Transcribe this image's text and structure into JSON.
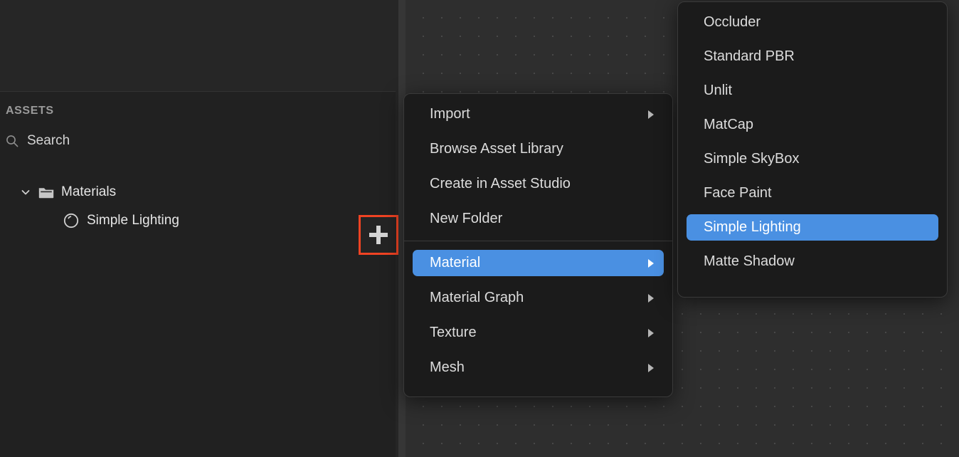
{
  "colors": {
    "accent_highlight": "#4a90e2",
    "annotation_outline": "#f04323",
    "panel_background": "#242424",
    "menu_background": "#1b1b1b",
    "viewport_background": "#2e2e2e",
    "text_primary": "#e6e6e6",
    "text_muted": "#9a9a9a"
  },
  "assets_panel": {
    "title": "ASSETS",
    "search": {
      "icon": "search-icon",
      "placeholder": "Search",
      "value": ""
    },
    "add_button": {
      "icon": "plus-icon",
      "label": "+",
      "highlighted": true
    },
    "tree": [
      {
        "label": "Materials",
        "icon": "folder-icon",
        "chevron": "chevron-down-icon",
        "expanded": true,
        "depth": 0
      },
      {
        "label": "Simple Lighting",
        "icon": "material-sphere-icon",
        "depth": 1
      }
    ]
  },
  "context_menu": {
    "items": [
      {
        "label": "Import",
        "has_submenu": true,
        "highlighted": false
      },
      {
        "label": "Browse Asset Library",
        "has_submenu": false,
        "highlighted": false
      },
      {
        "label": "Create in Asset Studio",
        "has_submenu": false,
        "highlighted": false
      },
      {
        "label": "New Folder",
        "has_submenu": false,
        "highlighted": false
      },
      {
        "label": "Material",
        "has_submenu": true,
        "highlighted": true
      },
      {
        "label": "Material Graph",
        "has_submenu": true,
        "highlighted": false
      },
      {
        "label": "Texture",
        "has_submenu": true,
        "highlighted": false
      },
      {
        "label": "Mesh",
        "has_submenu": true,
        "highlighted": false
      }
    ],
    "separator_after_index": 3
  },
  "submenu": {
    "parent": "Material",
    "items": [
      {
        "label": "Occluder",
        "highlighted": false
      },
      {
        "label": "Standard PBR",
        "highlighted": false
      },
      {
        "label": "Unlit",
        "highlighted": false
      },
      {
        "label": "MatCap",
        "highlighted": false
      },
      {
        "label": "Simple SkyBox",
        "highlighted": false
      },
      {
        "label": "Face Paint",
        "highlighted": false
      },
      {
        "label": "Simple Lighting",
        "highlighted": true
      },
      {
        "label": "Matte Shadow",
        "highlighted": false
      }
    ]
  }
}
